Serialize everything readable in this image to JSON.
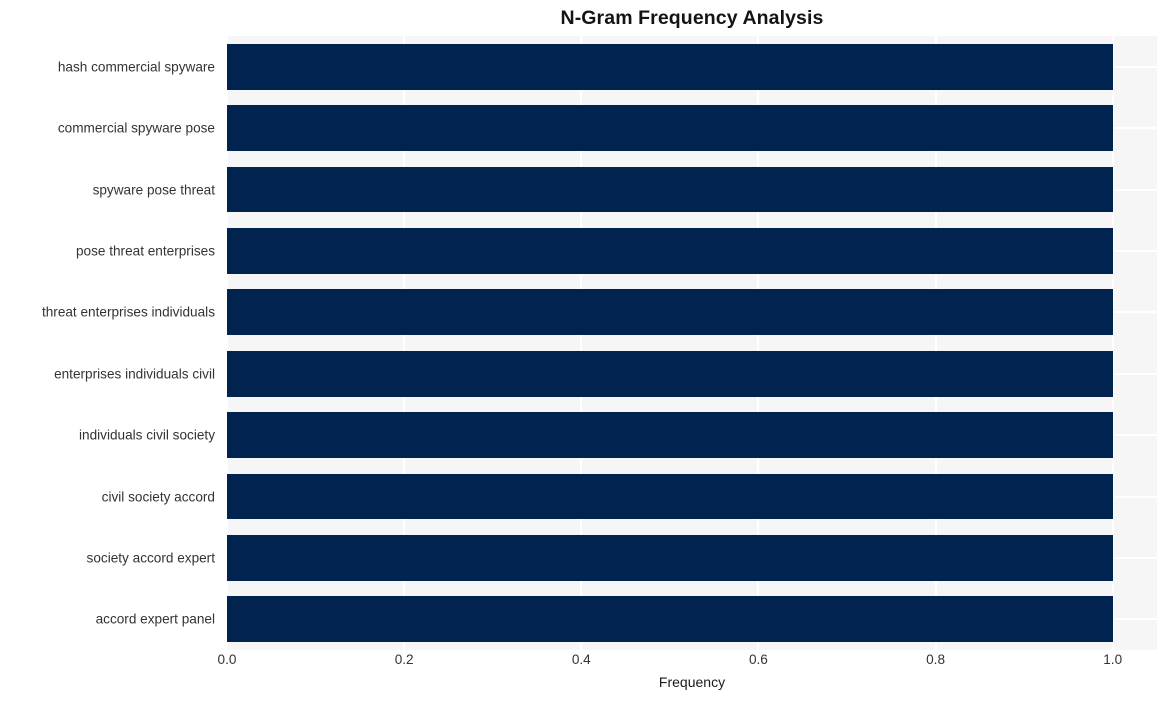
{
  "chart_data": {
    "type": "bar",
    "orientation": "horizontal",
    "title": "N-Gram Frequency Analysis",
    "xlabel": "Frequency",
    "ylabel": "",
    "categories": [
      "hash commercial spyware",
      "commercial spyware pose",
      "spyware pose threat",
      "pose threat enterprises",
      "threat enterprises individuals",
      "enterprises individuals civil",
      "individuals civil society",
      "civil society accord",
      "society accord expert",
      "accord expert panel"
    ],
    "values": [
      1.0,
      1.0,
      1.0,
      1.0,
      1.0,
      1.0,
      1.0,
      1.0,
      1.0,
      1.0
    ],
    "xlim": [
      0.0,
      1.05
    ],
    "xticks": [
      0.0,
      0.2,
      0.4,
      0.6,
      0.8,
      1.0
    ],
    "xtick_labels": [
      "0.0",
      "0.2",
      "0.4",
      "0.6",
      "0.8",
      "1.0"
    ],
    "grid": true,
    "legend": null,
    "bar_color": "#00234f",
    "plot_background": "#f6f6f6",
    "grid_color": "#ffffff",
    "figure_background": "#ffffff"
  }
}
